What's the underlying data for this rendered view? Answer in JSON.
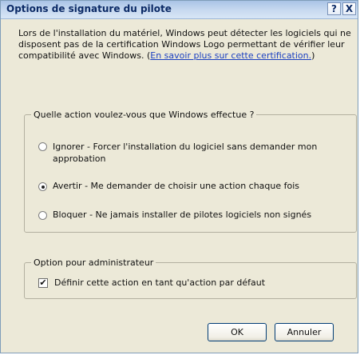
{
  "window": {
    "title": "Options de signature du pilote",
    "help_glyph": "?",
    "close_glyph": "X"
  },
  "intro": {
    "text": "Lors de l'installation du matériel, Windows peut détecter les logiciels qui ne disposent pas de la certification Windows Logo permettant de vérifier leur compatibilité avec Windows. (",
    "link": "En savoir plus sur cette certification.",
    "suffix": ")"
  },
  "action_group": {
    "legend": "Quelle action voulez-vous que Windows effectue ?",
    "options": [
      {
        "label": "Ignorer - Forcer l'installation du logiciel sans demander mon approbation",
        "selected": false
      },
      {
        "label": "Avertir - Me demander de choisir une action chaque fois",
        "selected": true
      },
      {
        "label": "Bloquer - Ne jamais installer de pilotes logiciels non signés",
        "selected": false
      }
    ]
  },
  "admin_group": {
    "legend": "Option pour administrateur",
    "checkbox_label": "Définir cette action en tant qu'action par défaut",
    "checked": true,
    "check_glyph": "✔"
  },
  "buttons": {
    "ok": "OK",
    "cancel": "Annuler"
  }
}
